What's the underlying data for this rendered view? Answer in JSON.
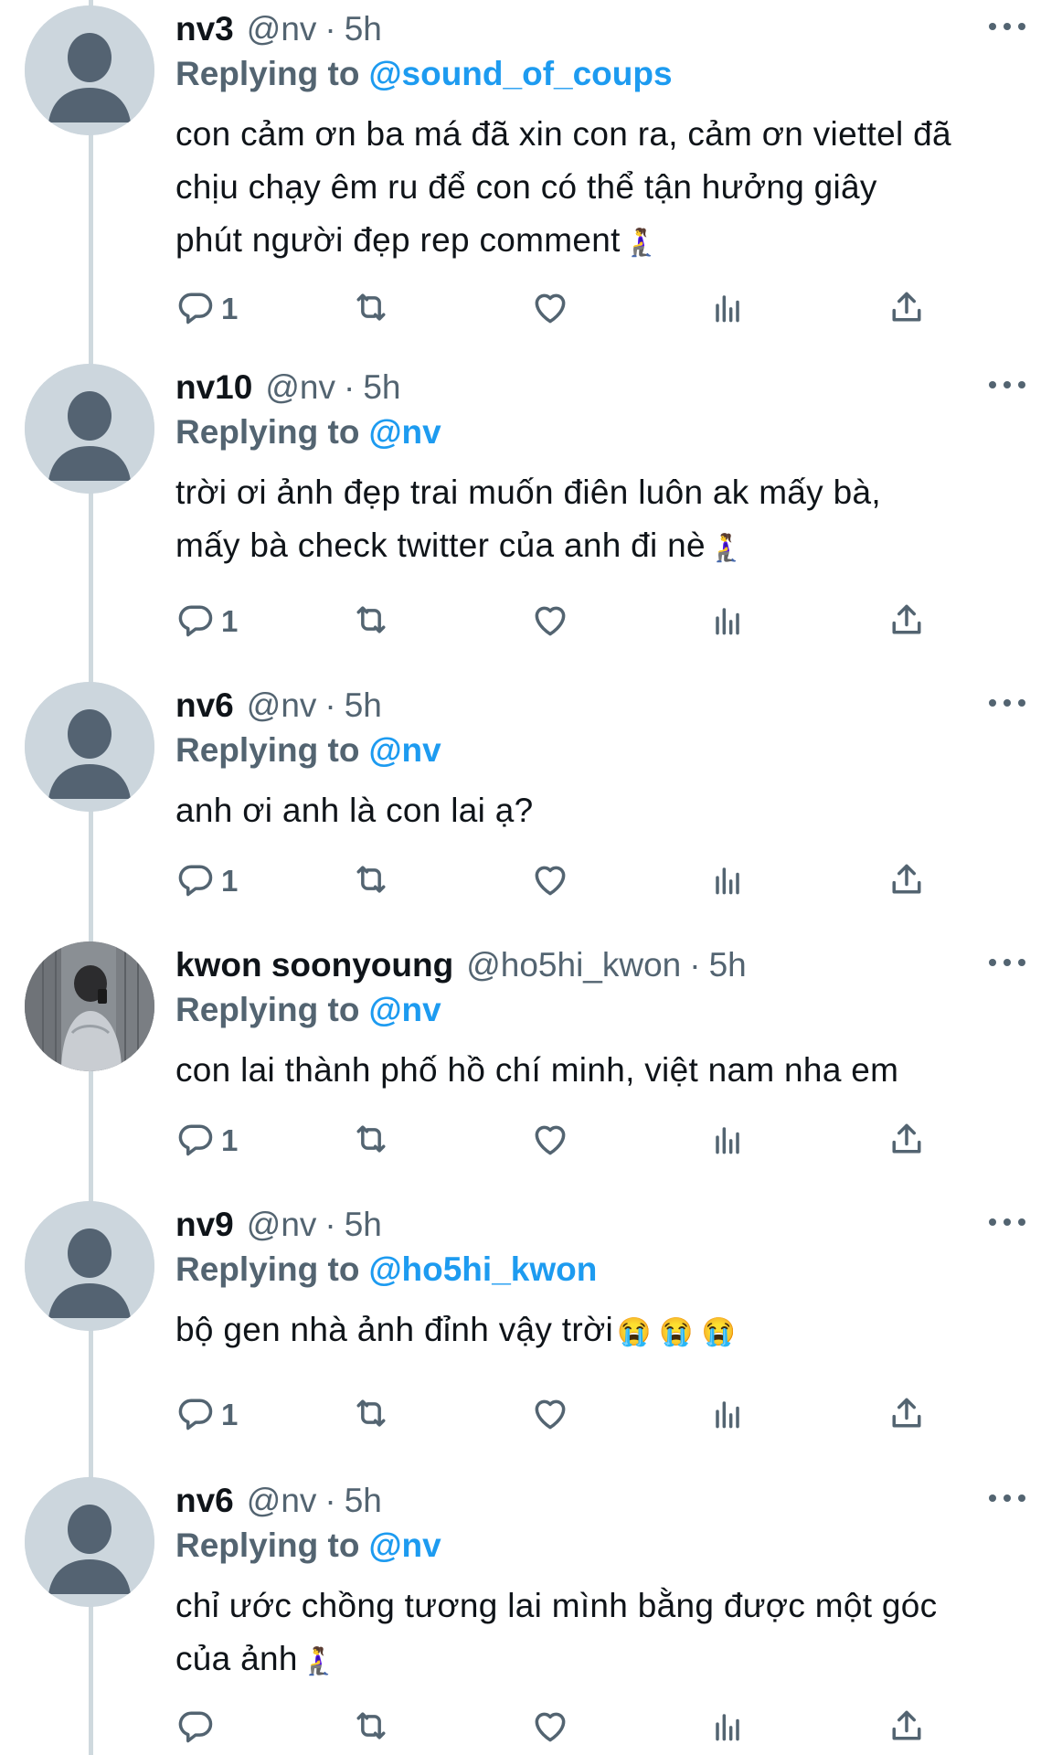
{
  "tweets": [
    {
      "name": "nv3",
      "handle": "@nv",
      "dot": "·",
      "time": "5h",
      "replying_prefix": "Replying to",
      "replying_to": "@sound_of_coups",
      "lines": [
        "con cảm ơn ba má đã xin con ra, cảm ơn viettel đã",
        "chịu chạy êm ru để con có thể tận hưởng giây",
        "phút người đẹp rep comment"
      ],
      "emoji": "🧎‍♀️",
      "reply_count": "1",
      "avatar": "default"
    },
    {
      "name": "nv10",
      "handle": "@nv",
      "dot": "·",
      "time": "5h",
      "replying_prefix": "Replying to",
      "replying_to": "@nv",
      "lines": [
        "trời ơi ảnh đẹp trai muốn điên luôn ak mấy bà,",
        "mấy bà check twitter của anh đi nè"
      ],
      "emoji": "🧎‍♀️",
      "reply_count": "1",
      "avatar": "default"
    },
    {
      "name": "nv6",
      "handle": "@nv",
      "dot": "·",
      "time": "5h",
      "replying_prefix": "Replying to",
      "replying_to": "@nv",
      "lines": [
        "anh ơi anh là con lai ạ?"
      ],
      "emoji": "",
      "reply_count": "1",
      "avatar": "default"
    },
    {
      "name": "kwon soonyoung",
      "handle": "@ho5hi_kwon",
      "dot": "·",
      "time": "5h",
      "replying_prefix": "Replying to",
      "replying_to": "@nv",
      "lines": [
        "con lai thành phố hồ chí minh, việt nam nha em"
      ],
      "emoji": "",
      "reply_count": "1",
      "avatar": "photo"
    },
    {
      "name": "nv9",
      "handle": "@nv",
      "dot": "·",
      "time": "5h",
      "replying_prefix": "Replying to",
      "replying_to": "@ho5hi_kwon",
      "lines": [
        "bộ gen nhà ảnh đỉnh vậy trời"
      ],
      "emoji": "😭 😭 😭",
      "reply_count": "1",
      "avatar": "default"
    },
    {
      "name": "nv6",
      "handle": "@nv",
      "dot": "·",
      "time": "5h",
      "replying_prefix": "Replying to",
      "replying_to": "@nv",
      "lines": [
        "chỉ ước chồng tương lai mình bằng được một góc",
        "của ảnh"
      ],
      "emoji": "🧎‍♀️",
      "reply_count": "",
      "avatar": "default"
    }
  ],
  "icons": {
    "reply": "reply-icon",
    "retweet": "retweet-icon",
    "like": "like-icon",
    "analytics": "analytics-icon",
    "share": "share-icon",
    "more": "more-icon"
  },
  "colors": {
    "accent": "#1d9bf0",
    "muted": "#536471",
    "text": "#0f1419",
    "avatar_bg": "#ccd6dd",
    "avatar_fg": "#546372"
  }
}
